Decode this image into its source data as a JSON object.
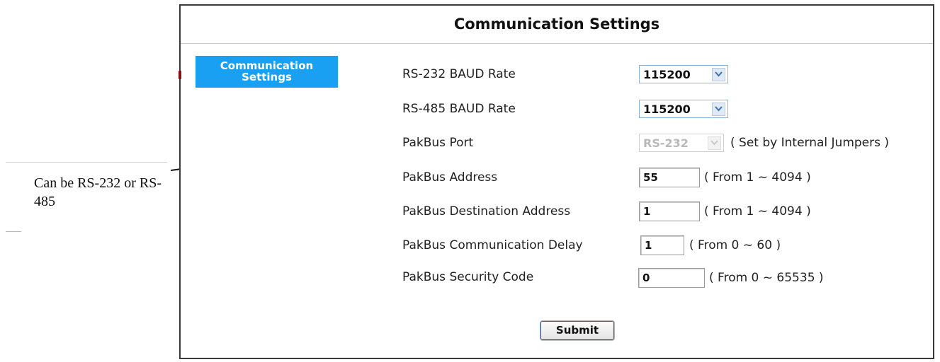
{
  "panel": {
    "title": "Communication Settings"
  },
  "nav": {
    "active_item": "Communication Settings"
  },
  "annotation": {
    "text": "Can be RS-232 or RS-485"
  },
  "form": {
    "rs232_baud": {
      "label": "RS-232 BAUD Rate",
      "value": "115200"
    },
    "rs485_baud": {
      "label": "RS-485 BAUD Rate",
      "value": "115200"
    },
    "pakbus_port": {
      "label": "PakBus Port",
      "value": "RS-232",
      "hint": "( Set by Internal Jumpers )"
    },
    "pakbus_address": {
      "label": "PakBus Address",
      "value": "55",
      "hint": "( From 1 ~ 4094 )"
    },
    "pakbus_dest": {
      "label": "PakBus Destination Address",
      "value": "1",
      "hint": "( From 1 ~ 4094 )"
    },
    "pakbus_delay": {
      "label": "PakBus Communication Delay",
      "value": "1",
      "hint": "( From 0 ~ 60 )"
    },
    "pakbus_security": {
      "label": "PakBus Security Code",
      "value": "0",
      "hint": "( From 0 ~ 65535 )"
    },
    "submit_label": "Submit"
  },
  "colors": {
    "nav_active_bg": "#1aa0f2",
    "panel_border": "#3a3a3a"
  }
}
